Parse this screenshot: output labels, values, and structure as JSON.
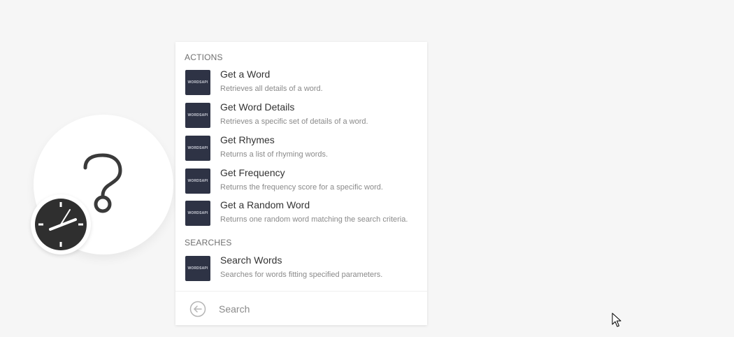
{
  "actions_section": {
    "title": "ACTIONS",
    "items": [
      {
        "logo": "WORDSAPI",
        "title": "Get a Word",
        "description": "Retrieves all details of a word."
      },
      {
        "logo": "WORDSAPI",
        "title": "Get Word Details",
        "description": "Retrieves a specific set of details of a word."
      },
      {
        "logo": "WORDSAPI",
        "title": "Get Rhymes",
        "description": "Returns a list of rhyming words."
      },
      {
        "logo": "WORDSAPI",
        "title": "Get Frequency",
        "description": "Returns the frequency score for a specific word."
      },
      {
        "logo": "WORDSAPI",
        "title": "Get a Random Word",
        "description": "Returns one random word matching the search criteria."
      }
    ]
  },
  "searches_section": {
    "title": "SEARCHES",
    "items": [
      {
        "logo": "WORDSAPI",
        "title": "Search Words",
        "description": "Searches for words fitting specified parameters."
      }
    ]
  },
  "search": {
    "placeholder": "Search",
    "value": ""
  },
  "icons": {
    "module": "question-mark-icon",
    "trigger": "clock-icon",
    "back": "back-arrow-icon",
    "pointer": "mouse-cursor-icon"
  },
  "colors": {
    "background": "#f6f6f6",
    "logo_tile": "#2e3345",
    "clock": "#2f2f2f",
    "title_text": "#333333",
    "desc_text": "#8a8a8a"
  }
}
